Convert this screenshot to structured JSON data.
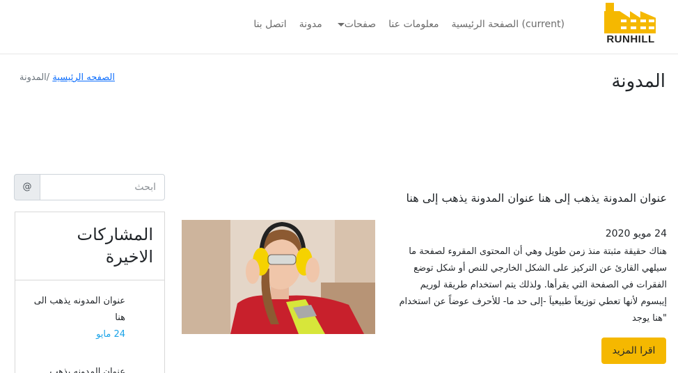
{
  "brand": {
    "name": "RUNHILL",
    "accent": "#f5b800"
  },
  "nav": {
    "home": "الصفحة الرئيسية (current)",
    "about": "معلومات عنا",
    "pages": "صفحات",
    "blog": "مدونة",
    "contact": "اتصل بنا"
  },
  "page": {
    "title": "المدونة",
    "breadcrumb_home": "الصفحه الرئيسية",
    "breadcrumb_sep": "/",
    "breadcrumb_current": "المدونة"
  },
  "post": {
    "title": "عنوان المدونة يذهب إلى هنا عنوان المدونة يذهب إلى هنا",
    "date": "24 مويو 2020",
    "body": "هناك حقيقة مثبتة منذ زمن طويل وهي أن المحتوى المقروء لصفحة ما سيلهي القارئ عن التركيز على الشكل الخارجي للنص أو شكل توضع الفقرات في الصفحة التي يقرأها. ولذلك يتم استخدام طريقة لوريم إيبسوم لأنها تعطي توزيعاَ طبيعياَ -إلى حد ما- للأحرف عوضاً عن استخدام \"هنا يوجد",
    "read_more": "اقرا المزيد",
    "image_icon": "worker-with-ear-muffs-image"
  },
  "sidebar": {
    "search_placeholder": "ابحث",
    "search_addon": "@",
    "recent_title": "المشاركات الاخيرة",
    "recent": [
      {
        "title": "عنوان المدونه يذهب الى هنا",
        "date": "24 مايو"
      },
      {
        "title": "عنوان المدونه يذهب",
        "date": ""
      }
    ]
  }
}
